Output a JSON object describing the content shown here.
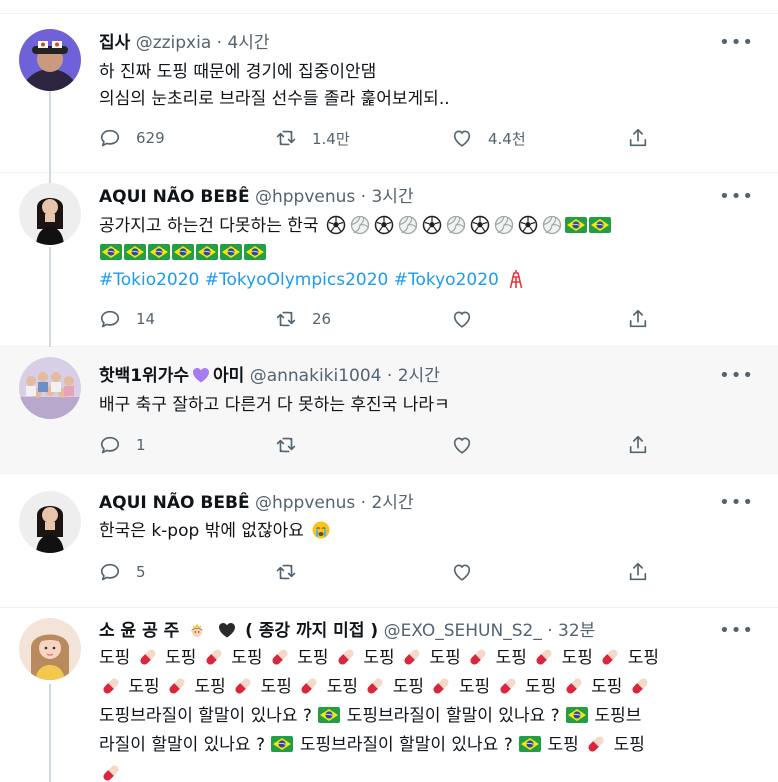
{
  "more_label": "•••",
  "tweets": [
    {
      "name": "집사",
      "handle": "@zzipxia",
      "sep": "·",
      "time": "4시간",
      "line1": "하 진짜 도핑 때문에 경기에 집중이안댐",
      "line2": "의심의 눈초리로 브라질 선수들 졸라 훑어보게되..",
      "reply_count": "629",
      "retweet_count": "1.4만",
      "like_count": "4.4천"
    },
    {
      "name": "AQUI NÃO BEBÊ",
      "handle": "@hppvenus",
      "sep": "·",
      "time": "3시간",
      "line1_text": "공가지고 하는건 다못하는 한국",
      "hashtags": [
        "#Tokio2020",
        "#TokyoOlympics2020",
        "#Tokyo2020"
      ],
      "reply_count": "14",
      "retweet_count": "26",
      "like_count": ""
    },
    {
      "name": "핫백1위가수",
      "name_suffix": "아미",
      "handle": "@annakiki1004",
      "sep": "·",
      "time": "2시간",
      "line1": "배구 축구 잘하고 다른거 다 못하는 후진국 나라ㅋ",
      "reply_count": "1",
      "retweet_count": "",
      "like_count": ""
    },
    {
      "name": "AQUI NÃO BEBÊ",
      "handle": "@hppvenus",
      "sep": "·",
      "time": "2시간",
      "line1_text": "한국은 k-pop 밖에 없잖아요",
      "reply_count": "5",
      "retweet_count": "",
      "like_count": ""
    },
    {
      "name_text": "소 윤 공 주",
      "name_tail": "( 종강 까지 미접 )",
      "handle": "@EXO_SEHUN_S2_",
      "sep": "·",
      "time": "32분",
      "word": "도핑",
      "sentence": "도핑브라질이 할말이 있나요 ?",
      "l3b": "도핑브",
      "l4a": "라질이 할말이 있나요 ?",
      "l4b": "도핑브라질이 할말이 있나요 ?"
    }
  ],
  "colors": {
    "hashtag": "#1d9bf0",
    "muted": "#536471",
    "divider": "#eff3f4",
    "highlight_bg": "#f7f7f7",
    "thread_line": "#cfd9de"
  }
}
